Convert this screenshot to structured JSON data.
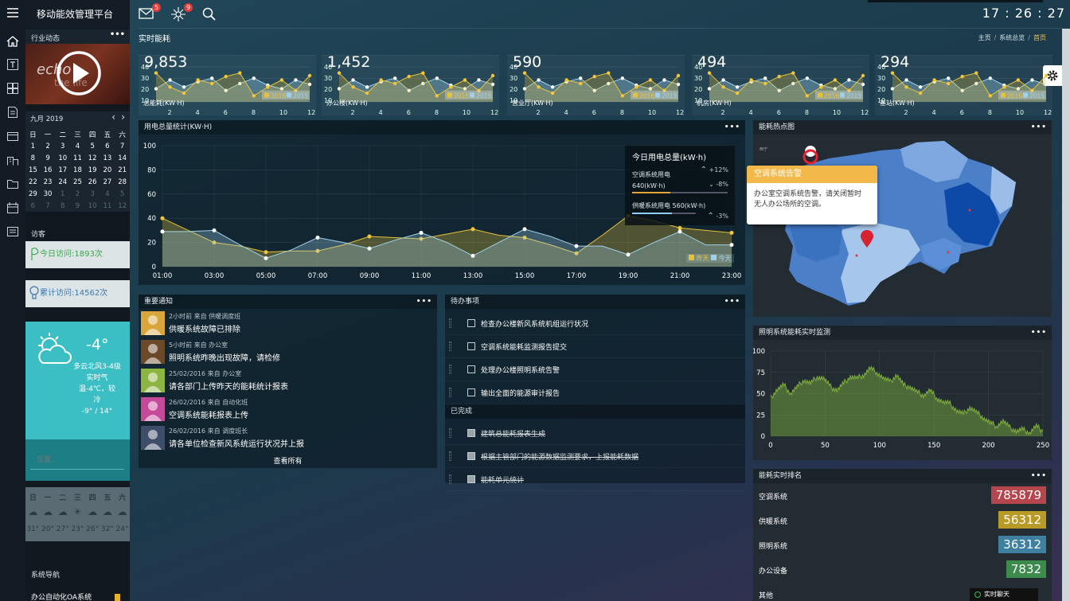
{
  "app": {
    "title": "移动能效管理平台",
    "clock": "17 : 26 : 27",
    "mail_badge": "5",
    "tasks_badge": "9"
  },
  "page": {
    "title": "实时能耗",
    "breadcrumb": [
      "主页",
      "系统总览",
      "首页"
    ]
  },
  "sidebar": {
    "news_title": "行业动态",
    "calendar": {
      "month": "九月 2019",
      "weekdays": [
        "日",
        "一",
        "二",
        "三",
        "四",
        "五",
        "六"
      ],
      "rows": [
        [
          "1",
          "2",
          "3",
          "4",
          "5",
          "6",
          "7"
        ],
        [
          "8",
          "9",
          "10",
          "11",
          "12",
          "13",
          "14"
        ],
        [
          "15",
          "16",
          "17",
          "18",
          "19",
          "20",
          "21"
        ],
        [
          "22",
          "23",
          "24",
          "25",
          "26",
          "27",
          "28"
        ],
        [
          "29",
          "30",
          "1",
          "2",
          "3",
          "4",
          "5"
        ],
        [
          "6",
          "7",
          "8",
          "9",
          "10",
          "11",
          "12"
        ]
      ]
    },
    "visitors_title": "访客",
    "today_visits": "今日访问:1893次",
    "total_visits": "累计访问:14562次",
    "weather": {
      "temp": "-4°",
      "desc": "多云北风3-4级",
      "live_label": "实时气",
      "live_desc": "温-4℃，较",
      "live_tail": "冷",
      "range": "-9° / 14°",
      "location_placeholder": "位置...",
      "week": [
        "日",
        "一",
        "二",
        "三",
        "四",
        "五",
        "六"
      ],
      "temps": [
        "31°",
        "20°",
        "27°",
        "23°",
        "26°",
        "32°",
        "24°"
      ]
    },
    "nav_title": "系统导航",
    "nav_item": "办公自动化OA系统"
  },
  "minis": [
    {
      "value": "9,853",
      "label": "总能耗(KW·H)"
    },
    {
      "value": "1,452",
      "label": "办公楼(KW·H)"
    },
    {
      "value": "590",
      "label": "营业厅(KW·H)"
    },
    {
      "value": "494",
      "label": "机房(KW·H)"
    },
    {
      "value": "294",
      "label": "基站(KW·H)"
    }
  ],
  "mini_common": {
    "x_ticks": [
      "2",
      "4",
      "6",
      "8",
      "10",
      "12"
    ],
    "y_ticks": [
      "40",
      "30",
      "20",
      "10"
    ],
    "legend": [
      "2016",
      "2015"
    ],
    "s2016": [
      38,
      22,
      15,
      30,
      26,
      34,
      38,
      12,
      22,
      30,
      18,
      35
    ],
    "s2015": [
      20,
      30,
      22,
      28,
      32,
      18,
      26,
      32,
      24,
      20,
      30,
      25
    ]
  },
  "main_chart": {
    "title": "用电总量统计(KW·H)",
    "legend": [
      "昨天",
      "今天"
    ],
    "info": {
      "title": "今日用电总量(kW·h)",
      "ac_label": "空调系统用电",
      "ac_value": "640(kW·h)",
      "ac_up": "+12%",
      "ac_down": "-8%",
      "heat_label": "供暖系统用电 560(kW·h)",
      "heat_down": "-3%"
    }
  },
  "map": {
    "title": "能耗热点图",
    "tip_title": "空调系统告警",
    "tip_body1": "办公室空调系统告警，请关闭暂时",
    "tip_body2": "无人办公场所的空调。",
    "small_label": "西宁"
  },
  "notices": {
    "title": "重要通知",
    "more": "查看所有",
    "items": [
      {
        "meta": "2小时前 来自 供暖调度班",
        "msg": "供暖系统故障已排除",
        "color": "#d8a63a"
      },
      {
        "meta": "5小时前 来自 办公室",
        "msg": "照明系统昨晚出现故障，请检修",
        "color": "#6b4a2a"
      },
      {
        "meta": "25/02/2016 来自 办公室",
        "msg": "请各部门上传昨天的能耗统计报表",
        "color": "#8cb542"
      },
      {
        "meta": "26/02/2016 来自 自动化班",
        "msg": "空调系统能耗报表上传",
        "color": "#c64a9c"
      },
      {
        "meta": "26/02/2016 来自 调度班长",
        "msg": "请各单位检查新风系统运行状况并上报",
        "color": "#3e4d6a"
      }
    ]
  },
  "todos": {
    "title": "待办事项",
    "done_title": "已完成",
    "pending": [
      "检查办公楼新风系统机组运行状况",
      "空调系统能耗监测报告提交",
      "处理办公楼照明系统告警",
      "输出全面的能源审计报告"
    ],
    "done": [
      "建筑总能耗报表生成",
      "根据主管部门的能源数据监测要求，上报能耗数据",
      "能耗单元统计"
    ]
  },
  "lighting": {
    "title": "照明系统能耗实时监测"
  },
  "ranking": {
    "title": "能耗实时排名",
    "chat": "实时聊天",
    "items": [
      {
        "name": "空调系统",
        "value": "785879",
        "color": "#b5464d"
      },
      {
        "name": "供暖系统",
        "value": "56312",
        "color": "#b89a26"
      },
      {
        "name": "照明系统",
        "value": "36312",
        "color": "#3f7fa0"
      },
      {
        "name": "办公设备",
        "value": "7832",
        "color": "#3c8a4c"
      },
      {
        "name": "其他",
        "value": "",
        "color": "#333"
      }
    ]
  },
  "chart_data": [
    {
      "type": "area",
      "title": "用电总量统计(KW·H)",
      "x": [
        "01:00",
        "02:00",
        "03:00",
        "04:00",
        "05:00",
        "06:00",
        "07:00",
        "08:00",
        "09:00",
        "10:00",
        "11:00",
        "12:00",
        "13:00",
        "14:00",
        "15:00",
        "16:00",
        "17:00",
        "18:00",
        "19:00",
        "20:00",
        "21:00",
        "22:00",
        "23:00"
      ],
      "ylim": [
        0,
        100
      ],
      "yticks": [
        0,
        20,
        40,
        60,
        80,
        100
      ],
      "xticks": [
        "01:00",
        "03:00",
        "05:00",
        "07:00",
        "09:00",
        "11:00",
        "13:00",
        "15:00",
        "17:00",
        "19:00",
        "21:00",
        "23:00"
      ],
      "series": [
        {
          "name": "昨天",
          "color": "#e6c23a",
          "values": [
            40,
            30,
            20,
            17,
            12,
            13,
            13,
            18,
            25,
            24,
            23,
            27,
            31,
            26,
            24,
            18,
            11,
            26,
            42,
            38,
            32,
            30,
            28
          ]
        },
        {
          "name": "今天",
          "color": "#9ed2ec",
          "values": [
            29,
            29,
            30,
            18,
            7,
            14,
            24,
            20,
            15,
            22,
            28,
            20,
            9,
            20,
            31,
            25,
            17,
            17,
            10,
            20,
            29,
            18,
            18
          ]
        }
      ]
    },
    {
      "type": "area",
      "title": "照明系统能耗实时监测",
      "xlim": [
        0,
        250
      ],
      "ylim": [
        0,
        100
      ],
      "xticks": [
        0,
        50,
        100,
        150,
        200,
        250
      ],
      "yticks": [
        0,
        25,
        50,
        75,
        100
      ],
      "series": [
        {
          "name": "",
          "color": "#6f9e3a",
          "values": [
            45,
            55,
            60,
            50,
            58,
            66,
            62,
            70,
            68,
            58,
            54,
            62,
            70,
            68,
            72,
            80,
            75,
            68,
            64,
            72,
            60,
            58,
            52,
            48,
            54,
            45,
            40,
            38,
            30,
            26,
            34,
            28,
            22,
            16,
            12,
            18,
            10,
            6,
            8,
            4,
            12,
            6
          ]
        }
      ]
    }
  ]
}
